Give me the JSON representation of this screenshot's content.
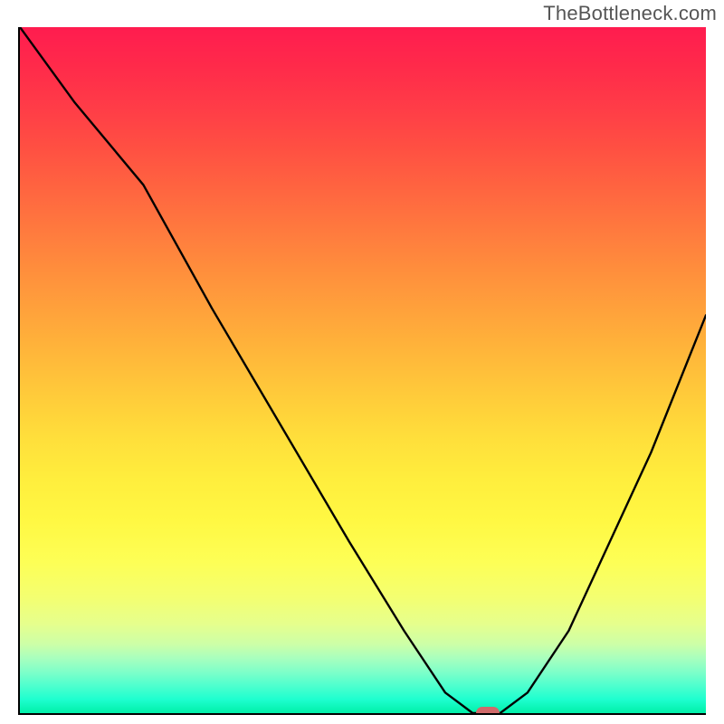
{
  "watermark": "TheBottleneck.com",
  "chart_data": {
    "type": "line",
    "title": "",
    "xlabel": "",
    "ylabel": "",
    "xlim": [
      0,
      100
    ],
    "ylim": [
      0,
      100
    ],
    "legend": false,
    "grid": false,
    "background": "rainbow-gradient-red-to-green",
    "series": [
      {
        "name": "bottleneck-curve",
        "x": [
          0,
          8,
          18,
          28,
          38,
          48,
          56,
          62,
          66,
          70,
          74,
          80,
          86,
          92,
          100
        ],
        "y": [
          100,
          89,
          77,
          59,
          42,
          25,
          12,
          3,
          0,
          0,
          3,
          12,
          25,
          38,
          58
        ]
      }
    ],
    "annotations": [
      {
        "name": "optimal-marker",
        "x": 68,
        "y": 0,
        "shape": "pill",
        "color": "#d06a6a"
      }
    ],
    "gradient_stops": [
      {
        "pos": 0.0,
        "hex": "#ff1c4f"
      },
      {
        "pos": 0.25,
        "hex": "#ff6640"
      },
      {
        "pos": 0.5,
        "hex": "#ffcc3a"
      },
      {
        "pos": 0.75,
        "hex": "#fdff56"
      },
      {
        "pos": 0.92,
        "hex": "#a8ffbe"
      },
      {
        "pos": 1.0,
        "hex": "#00f0a8"
      }
    ]
  }
}
